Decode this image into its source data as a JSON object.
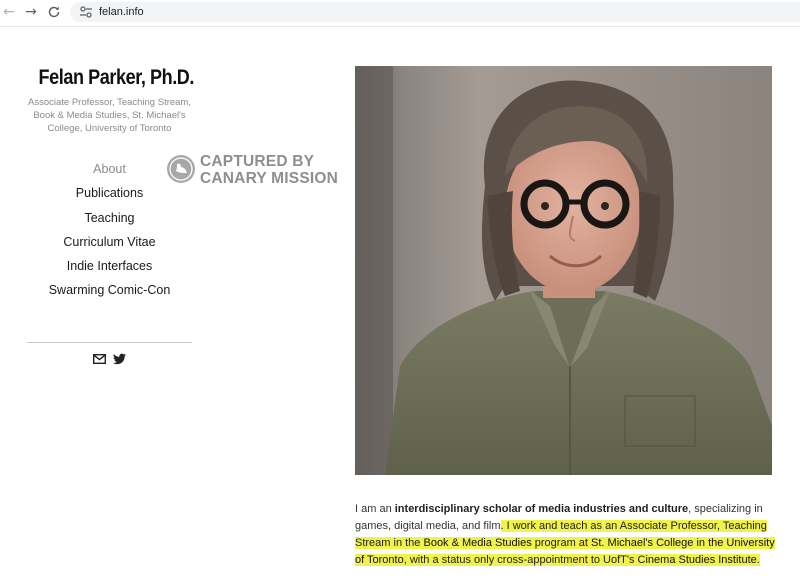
{
  "browser": {
    "url": "felan.info",
    "icons": [
      "back-arrow-icon",
      "forward-arrow-icon",
      "reload-icon",
      "site-settings-icon"
    ]
  },
  "sidebar": {
    "title": "Felan Parker, Ph.D.",
    "subtitle": "Associate Professor, Teaching Stream, Book & Media Studies, St. Michael's College, University of Toronto",
    "nav": [
      {
        "label": "About",
        "active": true
      },
      {
        "label": "Publications"
      },
      {
        "label": "Teaching"
      },
      {
        "label": "Curriculum Vitae"
      },
      {
        "label": "Indie Interfaces"
      },
      {
        "label": "Swarming Comic-Con"
      }
    ],
    "social_icons": [
      "mail-icon",
      "twitter-icon"
    ]
  },
  "watermark": {
    "line1": "CAPTURED BY",
    "line2": "CANARY MISSION"
  },
  "bio": {
    "p1": "I am an ",
    "b1": "interdisciplinary scholar of media industries and culture",
    "p2": ", specializing in games,  digital media, and film",
    "h1": ". I work and teach as an Associate Professor, Teaching Stream in the ",
    "h_b1": "Book & Media Studies",
    "h2": " program at ",
    "h_b2": "St. Michael's College in the University of Toronto",
    "h3": ", with a status only cross-appointment to UofT's ",
    "h_b3": "Cinema Studies Institute",
    "h4": "."
  },
  "colors": {
    "highlight": "#f1f34a",
    "title": "#111111",
    "muted": "#8c8c8c"
  }
}
